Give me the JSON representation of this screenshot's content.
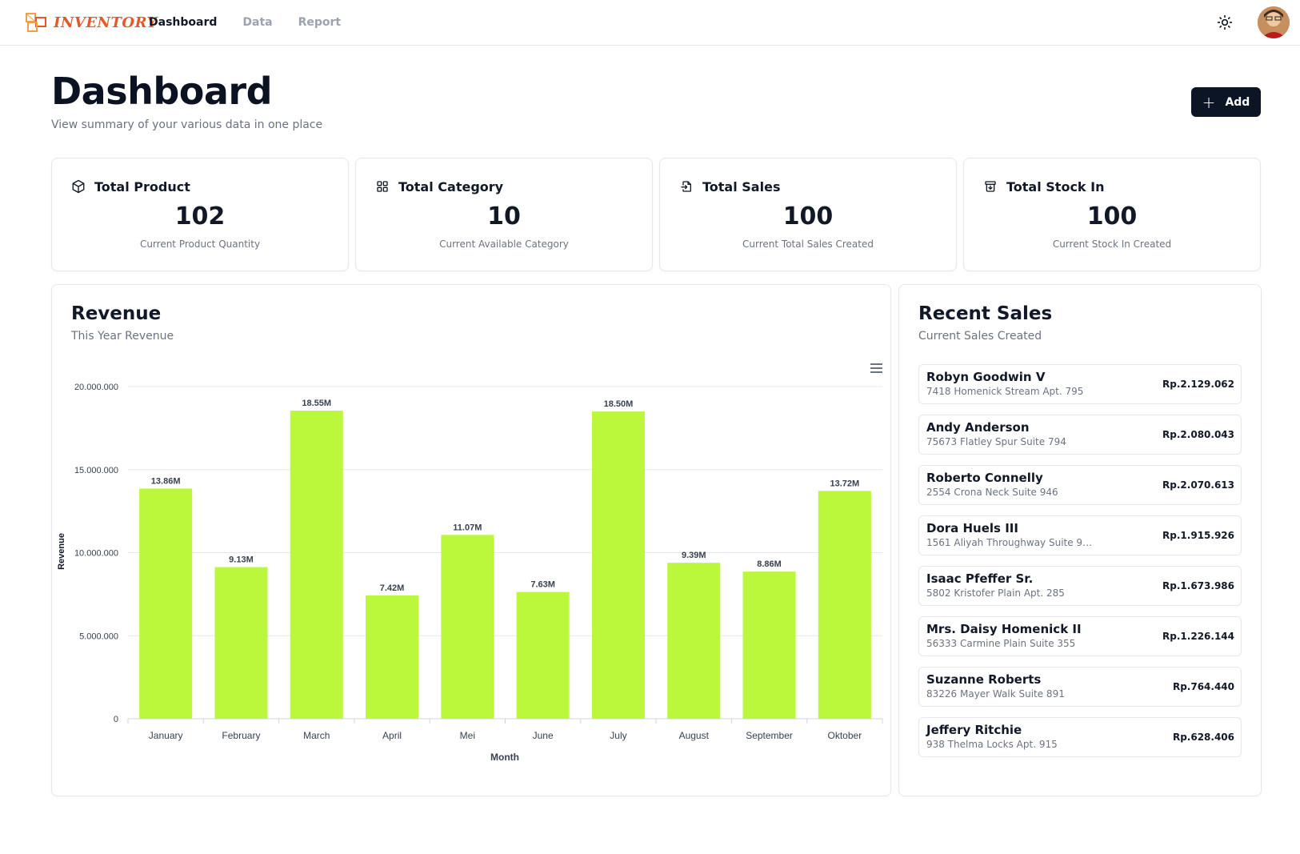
{
  "app": {
    "logo_text": "INVENTORY"
  },
  "nav": {
    "items": [
      "Dashboard",
      "Data",
      "Report"
    ]
  },
  "header": {
    "title": "Dashboard",
    "subtitle": "View summary of your various data in one place",
    "add_label": "Add"
  },
  "stats": [
    {
      "title": "Total Product",
      "value": "102",
      "desc": "Current Product Quantity",
      "icon": "box-icon"
    },
    {
      "title": "Total Category",
      "value": "10",
      "desc": "Current Available Category",
      "icon": "grid-icon"
    },
    {
      "title": "Total Sales",
      "value": "100",
      "desc": "Current Total Sales Created",
      "icon": "file-import-icon"
    },
    {
      "title": "Total Stock In",
      "value": "100",
      "desc": "Current Stock In Created",
      "icon": "archive-icon"
    }
  ],
  "revenue": {
    "title": "Revenue",
    "subtitle": "This Year Revenue"
  },
  "chart_data": {
    "type": "bar",
    "categories": [
      "January",
      "February",
      "March",
      "April",
      "Mei",
      "June",
      "July",
      "August",
      "September",
      "Oktober"
    ],
    "values": [
      13860000,
      9130000,
      18550000,
      7420000,
      11070000,
      7630000,
      18500000,
      9390000,
      8860000,
      13720000
    ],
    "data_labels": [
      "13.86M",
      "9.13M",
      "18.55M",
      "7.42M",
      "11.07M",
      "7.63M",
      "18.50M",
      "9.39M",
      "8.86M",
      "13.72M"
    ],
    "yticks": [
      "0",
      "5.000.000",
      "10.000.000",
      "15.000.000",
      "20.000.000"
    ],
    "ylim": [
      0,
      20000000
    ],
    "xlabel": "Month",
    "ylabel": "Revenue",
    "bar_color": "#bbf73a",
    "grid": true
  },
  "recent_sales": {
    "title": "Recent Sales",
    "subtitle": "Current Sales Created",
    "items": [
      {
        "name": "Robyn Goodwin V",
        "address": "7418 Homenick Stream Apt. 795",
        "amount": "Rp.2.129.062"
      },
      {
        "name": "Andy Anderson",
        "address": "75673 Flatley Spur Suite 794",
        "amount": "Rp.2.080.043"
      },
      {
        "name": "Roberto Connelly",
        "address": "2554 Crona Neck Suite 946",
        "amount": "Rp.2.070.613"
      },
      {
        "name": "Dora Huels III",
        "address": "1561 Aliyah Throughway Suite 9 ...",
        "amount": "Rp.1.915.926"
      },
      {
        "name": "Isaac Pfeffer Sr.",
        "address": "5802 Kristofer Plain Apt. 285",
        "amount": "Rp.1.673.986"
      },
      {
        "name": "Mrs. Daisy Homenick II",
        "address": "56333 Carmine Plain Suite 355",
        "amount": "Rp.1.226.144"
      },
      {
        "name": "Suzanne Roberts",
        "address": "83226 Mayer Walk Suite 891",
        "amount": "Rp.764.440"
      },
      {
        "name": "Jeffery Ritchie",
        "address": "938 Thelma Locks Apt. 915",
        "amount": "Rp.628.406"
      }
    ]
  }
}
